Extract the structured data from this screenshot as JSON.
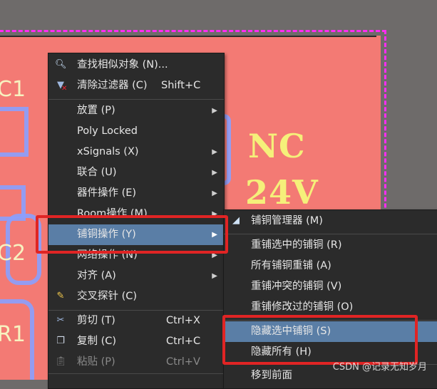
{
  "canvas": {
    "silk_texts": [
      "NC",
      "24V"
    ],
    "refdes": [
      "C1",
      "C2",
      "R1"
    ],
    "colors": {
      "board": "#f37a74",
      "outline": "#ff2cf2",
      "silk": "#f5f07a",
      "menu_bg": "#2b2b2b",
      "selected": "#5a7ea6",
      "highlight": "#e02424"
    }
  },
  "context_menu": {
    "items": [
      {
        "label": "查找相似对象 (N)...",
        "icon": "magnifier-icon"
      },
      {
        "label": "清除过滤器 (C)",
        "shortcut": "Shift+C",
        "icon": "clear-filter-icon"
      },
      {
        "label": "放置 (P)",
        "submenu": true
      },
      {
        "label": "Poly Locked"
      },
      {
        "label": "xSignals (X)",
        "submenu": true
      },
      {
        "label": "联合 (U)",
        "submenu": true
      },
      {
        "label": "器件操作 (E)",
        "submenu": true
      },
      {
        "label": "Room操作 (M)",
        "submenu": true
      },
      {
        "label": "铺铜操作 (Y)",
        "submenu": true
      },
      {
        "label": "网络操作 (N)",
        "submenu": true
      },
      {
        "label": "对齐 (A)",
        "submenu": true
      },
      {
        "label": "交叉探针 (C)",
        "icon": "cross-probe-icon"
      },
      {
        "label": "剪切 (T)",
        "shortcut": "Ctrl+X",
        "icon": "scissors-icon"
      },
      {
        "label": "复制 (C)",
        "shortcut": "Ctrl+C",
        "icon": "copy-icon"
      },
      {
        "label": "粘贴 (P)",
        "shortcut": "Ctrl+V",
        "icon": "paste-icon"
      }
    ]
  },
  "submenu": {
    "items": [
      {
        "label": "铺铜管理器 (M)",
        "icon": "polygon-manager-icon"
      },
      {
        "label": "重铺选中的铺铜 (R)"
      },
      {
        "label": "所有铺铜重铺 (A)"
      },
      {
        "label": "重铺冲突的铺铜 (V)"
      },
      {
        "label": "重铺修改过的铺铜 (O)"
      },
      {
        "label": "隐藏选中铺铜 (S)"
      },
      {
        "label": "隐藏所有 (H)"
      },
      {
        "label": "移到前面"
      }
    ]
  },
  "watermark": "CSDN @记录无知岁月"
}
